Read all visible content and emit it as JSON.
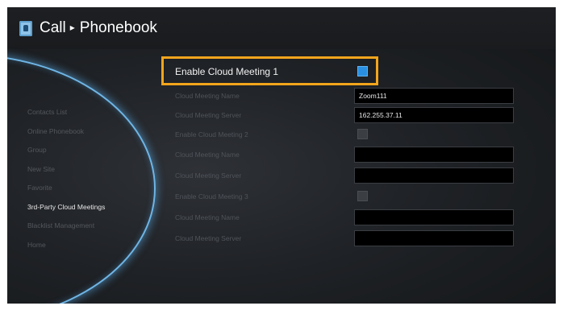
{
  "header": {
    "section": "Call",
    "page": "Phonebook",
    "separator": "▸"
  },
  "sidebar": {
    "items": [
      {
        "label": "Contacts List",
        "active": false
      },
      {
        "label": "Online Phonebook",
        "active": false
      },
      {
        "label": "Group",
        "active": false
      },
      {
        "label": "New Site",
        "active": false
      },
      {
        "label": "Favorite",
        "active": false
      },
      {
        "label": "3rd-Party Cloud Meetings",
        "active": true
      },
      {
        "label": "Blacklist Management",
        "active": false
      },
      {
        "label": "Home",
        "active": false
      }
    ]
  },
  "settings": {
    "enable1": {
      "label": "Enable Cloud Meeting 1",
      "checked": true
    },
    "name1": {
      "label": "Cloud Meeting Name",
      "value": "Zoom111"
    },
    "server1": {
      "label": "Cloud Meeting Server",
      "value": "162.255.37.11"
    },
    "enable2": {
      "label": "Enable Cloud Meeting 2",
      "checked": false
    },
    "name2": {
      "label": "Cloud Meeting Name",
      "value": ""
    },
    "server2": {
      "label": "Cloud Meeting Server",
      "value": ""
    },
    "enable3": {
      "label": "Enable Cloud Meeting 3",
      "checked": false
    },
    "name3": {
      "label": "Cloud Meeting Name",
      "value": ""
    },
    "server3": {
      "label": "Cloud Meeting Server",
      "value": ""
    }
  },
  "colors": {
    "highlight": "#f3a51c",
    "checkbox_on": "#2a8fe0",
    "accent_glow": "#6fb6e6"
  },
  "icons": {
    "header": "phonebook-icon"
  }
}
